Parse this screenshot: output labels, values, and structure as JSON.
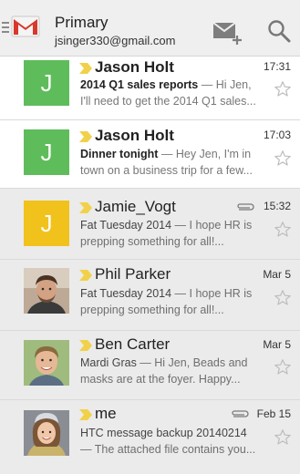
{
  "header": {
    "title": "Primary",
    "account_email": "jsinger330@gmail.com"
  },
  "colors": {
    "avatar_green": "#5fbc5b",
    "avatar_yellow": "#f1c21b",
    "chevron": "#f2d14a",
    "gmail_red": "#d8382c"
  },
  "messages": [
    {
      "sender": "Jason Holt",
      "time": "17:31",
      "subject": "2014 Q1 sales reports",
      "preview": " — Hi Jen, I'll need to get the 2014 Q1 sales...",
      "avatar_letter": "J",
      "unread": true,
      "attachment": false
    },
    {
      "sender": "Jason Holt",
      "time": "17:03",
      "subject": "Dinner tonight",
      "preview": " — Hey Jen, I'm in town on a business trip for a few...",
      "avatar_letter": "J",
      "unread": true,
      "attachment": false
    },
    {
      "sender": "Jamie_Vogt",
      "time": "15:32",
      "subject": "Fat Tuesday 2014",
      "preview": " — I hope HR is prepping something for all!...",
      "avatar_letter": "J",
      "unread": false,
      "attachment": true
    },
    {
      "sender": "Phil Parker",
      "time": "Mar 5",
      "subject": "Fat Tuesday 2014",
      "preview": " — I hope HR is prepping something for all!...",
      "avatar_letter": "",
      "unread": false,
      "attachment": false
    },
    {
      "sender": "Ben Carter",
      "time": "Mar 5",
      "subject": "Mardi Gras",
      "preview": " — Hi Jen, Beads and masks are at the foyer. Happy...",
      "avatar_letter": "",
      "unread": false,
      "attachment": false
    },
    {
      "sender": "me",
      "time": "Feb 15",
      "subject": "HTC message backup 20140214",
      "preview": " — The attached file contains you...",
      "avatar_letter": "",
      "unread": false,
      "attachment": true
    }
  ]
}
